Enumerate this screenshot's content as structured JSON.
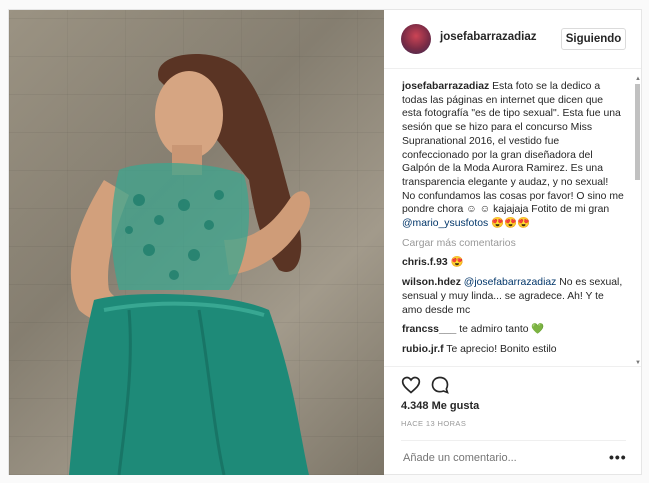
{
  "post": {
    "username": "josefabarrazadiaz",
    "follow_label": "Siguiendo",
    "caption_user": "josefabarrazadiaz",
    "caption_text": "Esta foto se la dedico a todas las páginas en internet que dicen que esta fotografía \"es de tipo sexual\". Esta fue una sesión que se hizo para el concurso Miss Supranational 2016, el vestido fue confeccionado por la gran diseñadora del Galpón de la Moda Aurora Ramirez. Es una transparencia elegante y audaz, y no sexual! No confundamos las cosas por favor! O sino me pondre chora ☺ ☺ kajajaja Fotito de mi gran",
    "caption_mention": "@mario_ysusfotos",
    "caption_emoji": "😍😍😍",
    "load_more": "Cargar más comentarios",
    "comments": [
      {
        "user": "chris.f.93",
        "text": "😍",
        "mention": ""
      },
      {
        "user": "wilson.hdez",
        "mention": "@josefabarrazadiaz",
        "text": "No es sexual, sensual y muy linda... se agradece. Ah! Y te amo desde mc"
      },
      {
        "user": "francss___",
        "text": "te admiro tanto 💚",
        "mention": ""
      },
      {
        "user": "rubio.jr.f",
        "text": "Te aprecio! Bonito estilo",
        "mention": ""
      }
    ],
    "likes": "4.348 Me gusta",
    "time": "HACE 13 HORAS",
    "add_comment_placeholder": "Añade un comentario...",
    "more": "•••",
    "icons": {
      "like": "heart-icon",
      "comment": "comment-bubble-icon",
      "options": "more-options-icon"
    },
    "colors": {
      "link": "#003569",
      "dress": "#1e8a78",
      "border": "#e6e6e6"
    }
  }
}
